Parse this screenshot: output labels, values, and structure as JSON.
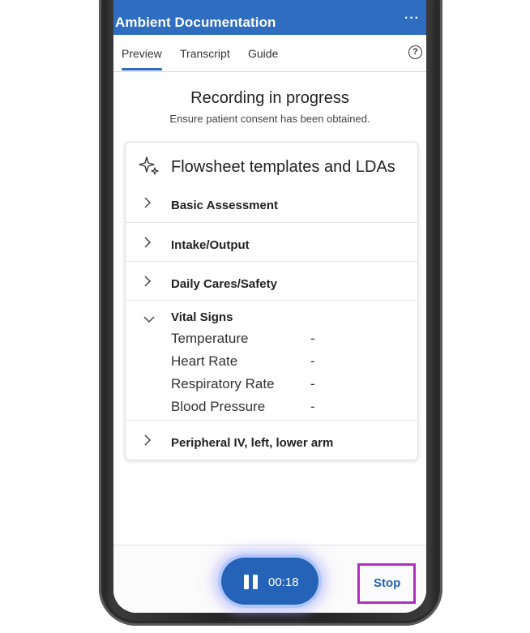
{
  "app": {
    "title": "Ambient Documentation",
    "more": "···"
  },
  "tabs": [
    {
      "label": "Preview",
      "active": true
    },
    {
      "label": "Transcript",
      "active": false
    },
    {
      "label": "Guide",
      "active": false
    }
  ],
  "help": {
    "glyph": "?"
  },
  "status": {
    "heading": "Recording in progress",
    "subheading": "Ensure patient consent has been obtained."
  },
  "card": {
    "title": "Flowsheet templates and LDAs",
    "sections": [
      {
        "label": "Basic Assessment",
        "expanded": false
      },
      {
        "label": "Intake/Output",
        "expanded": false
      },
      {
        "label": "Daily Cares/Safety",
        "expanded": false
      },
      {
        "label": "Vital Signs",
        "expanded": true
      },
      {
        "label": "Peripheral IV, left, lower arm",
        "expanded": false
      }
    ],
    "vitals": [
      {
        "name": "Temperature",
        "value": "-"
      },
      {
        "name": "Heart Rate",
        "value": "-"
      },
      {
        "name": "Respiratory Rate",
        "value": "-"
      },
      {
        "name": "Blood Pressure",
        "value": "-"
      }
    ]
  },
  "recorder": {
    "time": "00:18",
    "stop_label": "Stop"
  },
  "colors": {
    "brand": "#2f6dc0",
    "accent": "#2563b8",
    "highlight": "#b02fbd"
  }
}
